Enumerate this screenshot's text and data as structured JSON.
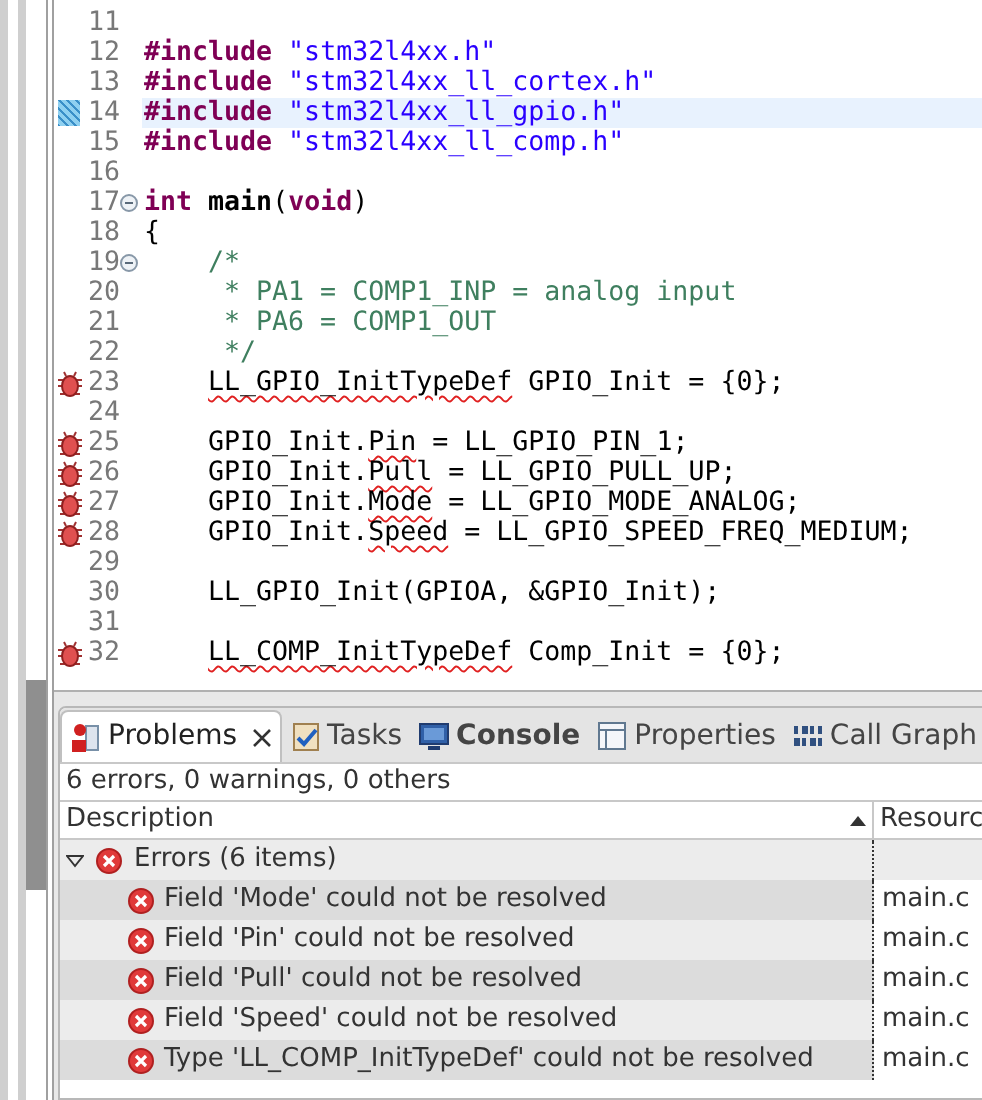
{
  "editor": {
    "lines": [
      {
        "number": "11"
      },
      {
        "number": "12",
        "segments": [
          {
            "text": "#include",
            "kind": "keyword"
          },
          {
            "text": " \"stm32l4xx.h\"",
            "kind": "string"
          }
        ]
      },
      {
        "number": "13",
        "segments": [
          {
            "text": "#include",
            "kind": "keyword"
          },
          {
            "text": " \"stm32l4xx_ll_cortex.h\"",
            "kind": "string"
          }
        ]
      },
      {
        "number": "14",
        "bookmarked": true,
        "current": true,
        "segments": [
          {
            "text": "#include",
            "kind": "keyword"
          },
          {
            "text": " \"stm32l4xx_ll_gpio.h\"",
            "kind": "string"
          }
        ]
      },
      {
        "number": "15",
        "segments": [
          {
            "text": "#include",
            "kind": "keyword"
          },
          {
            "text": " \"stm32l4xx_ll_comp.h\"",
            "kind": "string"
          }
        ]
      },
      {
        "number": "16"
      },
      {
        "number": "17",
        "fold_control": true,
        "segments": [
          {
            "text": "int",
            "kind": "keyword"
          },
          {
            "text": " main",
            "kind": "bold"
          },
          {
            "text": "("
          },
          {
            "text": "void",
            "kind": "keyword"
          },
          {
            "text": ")"
          }
        ]
      },
      {
        "number": "18",
        "segments": [
          {
            "text": "{"
          }
        ]
      },
      {
        "number": "19",
        "fold_control": true,
        "indented": true,
        "segments": [
          {
            "text": "/*",
            "kind": "comment"
          }
        ]
      },
      {
        "number": "20",
        "indented": true,
        "segments": [
          {
            "text": " * PA1 = COMP1_INP = analog input",
            "kind": "comment"
          }
        ]
      },
      {
        "number": "21",
        "indented": true,
        "segments": [
          {
            "text": " * PA6 = COMP1_OUT",
            "kind": "comment"
          }
        ]
      },
      {
        "number": "22",
        "indented": true,
        "segments": [
          {
            "text": " */",
            "kind": "comment"
          }
        ]
      },
      {
        "number": "23",
        "has_error": true,
        "indented": true,
        "segments": [
          {
            "text": "LL_GPIO_InitTypeDef",
            "squiggle": true
          },
          {
            "text": " GPIO_Init = {0};"
          }
        ]
      },
      {
        "number": "24"
      },
      {
        "number": "25",
        "has_error": true,
        "indented": true,
        "segments": [
          {
            "text": "GPIO_Init."
          },
          {
            "text": "Pin",
            "squiggle": true
          },
          {
            "text": " = LL_GPIO_PIN_1;"
          }
        ]
      },
      {
        "number": "26",
        "has_error": true,
        "indented": true,
        "segments": [
          {
            "text": "GPIO_Init."
          },
          {
            "text": "Pull",
            "squiggle": true
          },
          {
            "text": " = LL_GPIO_PULL_UP;"
          }
        ]
      },
      {
        "number": "27",
        "has_error": true,
        "indented": true,
        "segments": [
          {
            "text": "GPIO_Init."
          },
          {
            "text": "Mode",
            "squiggle": true
          },
          {
            "text": " = LL_GPIO_MODE_ANALOG;"
          }
        ]
      },
      {
        "number": "28",
        "has_error": true,
        "indented": true,
        "segments": [
          {
            "text": "GPIO_Init."
          },
          {
            "text": "Speed",
            "squiggle": true
          },
          {
            "text": " = LL_GPIO_SPEED_FREQ_MEDIUM;"
          }
        ]
      },
      {
        "number": "29"
      },
      {
        "number": "30",
        "indented": true,
        "segments": [
          {
            "text": "LL_GPIO_Init(GPIOA, &GPIO_Init);"
          }
        ]
      },
      {
        "number": "31"
      },
      {
        "number": "32",
        "has_error": true,
        "indented": true,
        "segments": [
          {
            "text": "LL_COMP_InitTypeDef",
            "squiggle": true
          },
          {
            "text": " Comp_Init = {0};"
          }
        ]
      }
    ]
  },
  "panel": {
    "tabs": [
      {
        "label": "Problems",
        "selected": true,
        "closable": true
      },
      {
        "label": "Tasks",
        "selected": false
      },
      {
        "label": "Console",
        "selected": false,
        "bold": true
      },
      {
        "label": "Properties",
        "selected": false
      },
      {
        "label": "Call Graph",
        "selected": false
      }
    ],
    "summary": "6 errors, 0 warnings, 0 others",
    "columns": [
      "Description",
      "Resourc"
    ],
    "groups": [
      {
        "label": "Errors (6 items)",
        "expanded": true,
        "items": [
          {
            "description": "Field 'Mode' could not be resolved",
            "resource": "main.c"
          },
          {
            "description": "Field 'Pin' could not be resolved",
            "resource": "main.c"
          },
          {
            "description": "Field 'Pull' could not be resolved",
            "resource": "main.c"
          },
          {
            "description": "Field 'Speed' could not be resolved",
            "resource": "main.c"
          },
          {
            "description": "Type 'LL_COMP_InitTypeDef' could not be resolved",
            "resource": "main.c"
          }
        ]
      }
    ]
  }
}
